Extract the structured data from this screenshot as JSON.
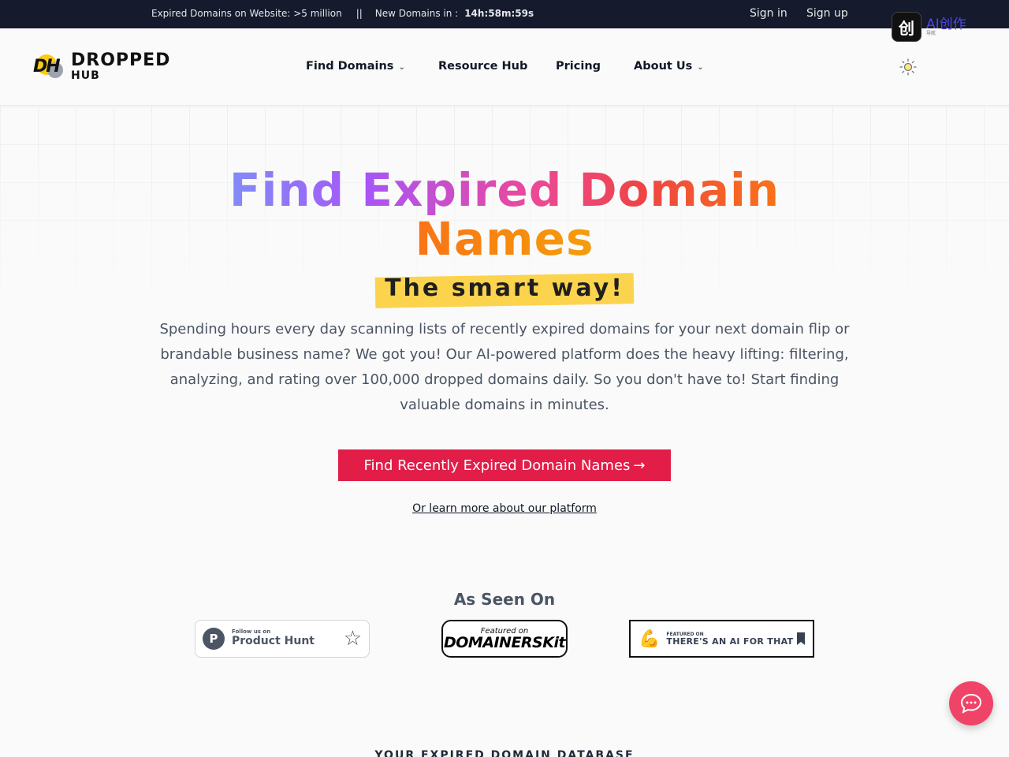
{
  "topbar": {
    "expired_label": "Expired Domains on Website: >5 million",
    "separator": "||",
    "new_label": "New Domains in :",
    "timer": "14h:58m:59s",
    "sign_in": "Sign in",
    "sign_up": "Sign up"
  },
  "ai_badge": {
    "tile": "创",
    "text": "AI创作",
    "sub_text": "导航"
  },
  "brand": {
    "mark": "DH",
    "line1": "DROPPED",
    "line2": "HUB"
  },
  "nav": {
    "items": [
      {
        "label": "Find Domains",
        "has_dropdown": true
      },
      {
        "label": "Resource Hub",
        "has_dropdown": false
      },
      {
        "label": "Pricing",
        "has_dropdown": false
      },
      {
        "label": "About Us",
        "has_dropdown": true
      }
    ],
    "theme_icon": "sun-icon"
  },
  "hero": {
    "title_line1": "Find Expired Domain",
    "title_line2": "Names",
    "highlight": "The smart way!",
    "description": "Spending hours every day scanning lists of recently expired domains for your next domain flip or brandable business name? We got you! Our AI-powered platform does the heavy lifting: filtering, analyzing, and rating over 100,000 dropped domains daily. So you don't have to! Start finding valuable domains in minutes.",
    "cta_label": "Find Recently Expired Domain Names",
    "cta_arrow": "→",
    "learn_more": "Or learn more about our platform"
  },
  "as_seen_on": {
    "title": "As Seen On",
    "product_hunt": {
      "small": "Follow us on",
      "big": "Product Hunt",
      "letter": "P"
    },
    "domainers_kit": {
      "small": "Featured on",
      "big": "DOMAINERSKit"
    },
    "ai_for_that": {
      "small": "FEATURED ON",
      "big": "THERE'S AN AI FOR THAT"
    }
  },
  "database_heading": "YOUR EXPIRED DOMAIN DATABASE",
  "colors": {
    "topbar_bg": "#151a2d",
    "cta_bg": "#e11d48",
    "highlight_bg": "#fcd34d",
    "chat_bg": "#ef4468"
  }
}
